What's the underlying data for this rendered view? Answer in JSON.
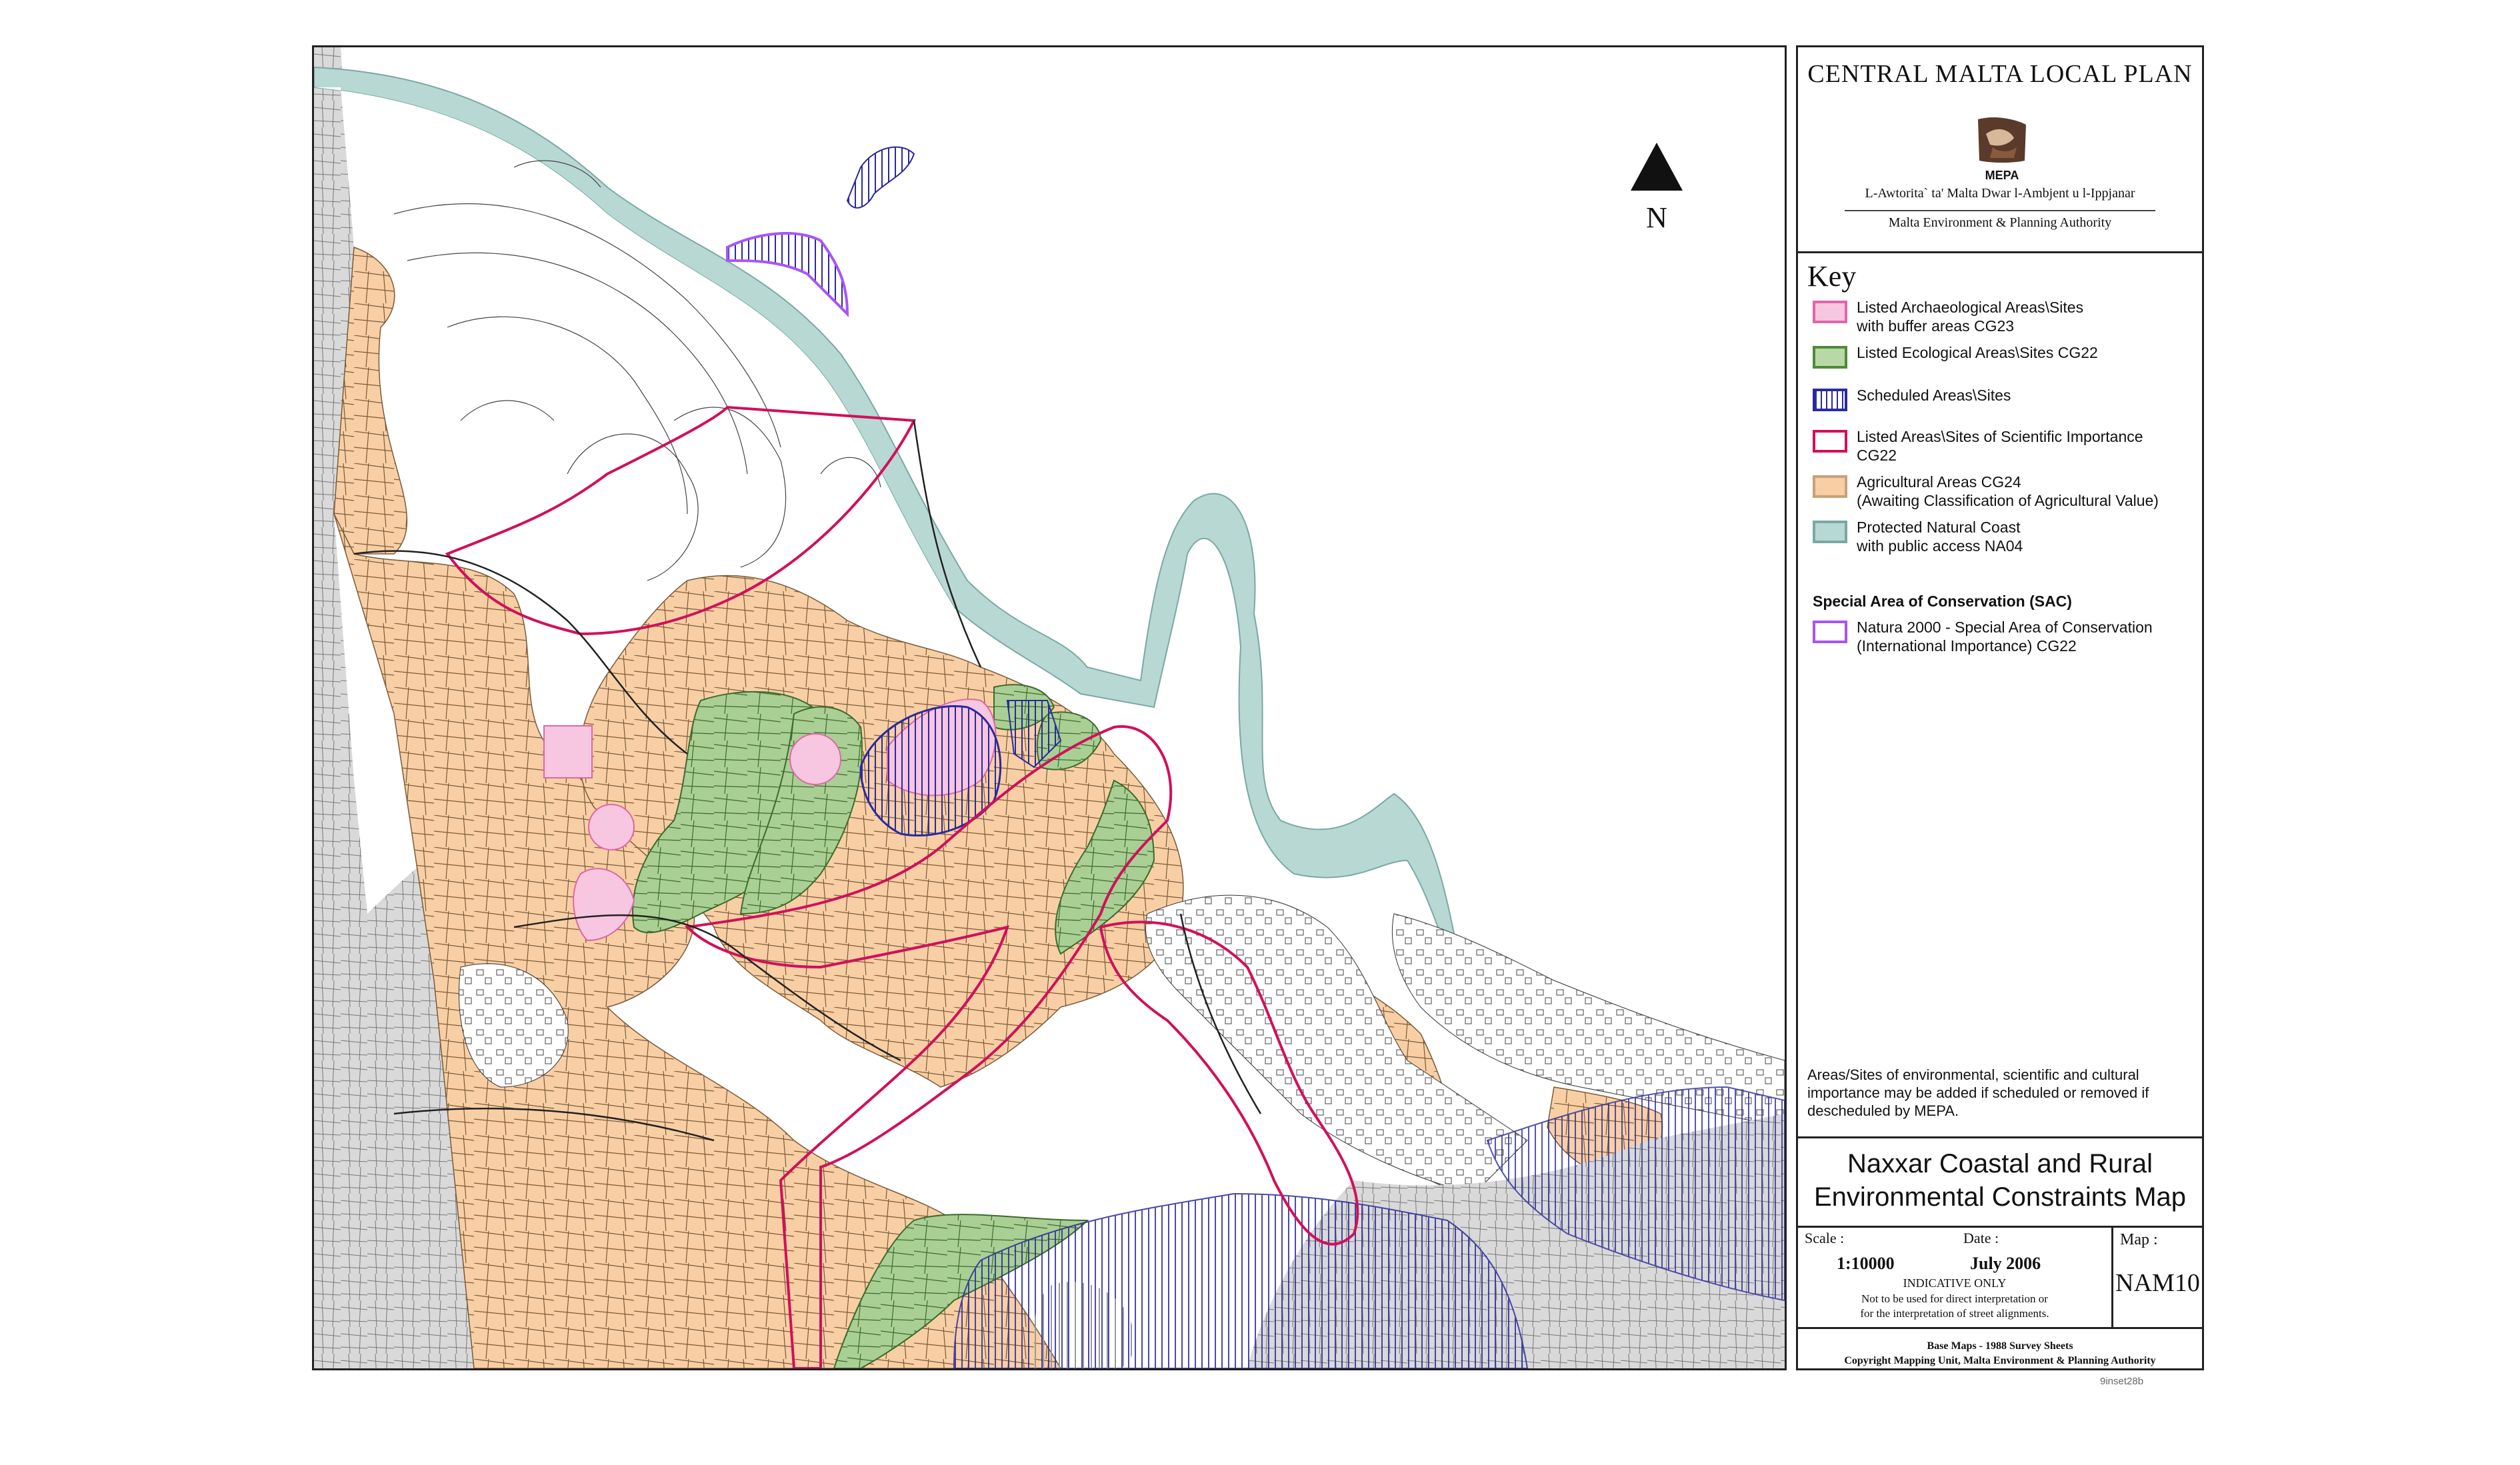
{
  "map": {
    "north_label": "N",
    "colors": {
      "archaeological_fill": "#f7c6e0",
      "archaeological_border": "#e066a8",
      "ecological_fill": "#b8d9a6",
      "ecological_border": "#4f8a3a",
      "scheduled_border": "#2a2aa0",
      "scientific_border": "#d1105a",
      "agricultural_fill": "#f8cfa4",
      "coast_fill": "#b8d8d4",
      "coast_border": "#7aa8a4",
      "sac_border": "#a855f7",
      "built_grey": "#d9d9d9"
    }
  },
  "panel": {
    "plan_title": "CENTRAL MALTA LOCAL PLAN",
    "logo_label": "MEPA",
    "authority_local": "L-Awtorita` ta' Malta Dwar l-Ambjent u l-Ippjanar",
    "authority_en": "Malta Environment & Planning Authority",
    "key_heading": "Key",
    "legend": [
      {
        "line1": "Listed Archaeological Areas\\Sites",
        "line2": "with buffer areas CG23"
      },
      {
        "line1": "Listed Ecological Areas\\Sites CG22",
        "line2": ""
      },
      {
        "line1": "Scheduled Areas\\Sites",
        "line2": ""
      },
      {
        "line1": "Listed Areas\\Sites of Scientific Importance",
        "line2": "CG22"
      },
      {
        "line1": "Agricultural Areas CG24",
        "line2": "(Awaiting Classification of Agricultural Value)"
      },
      {
        "line1": "Protected Natural Coast",
        "line2": "with public access NA04"
      }
    ],
    "sac_heading": "Special Area of Conservation (SAC)",
    "sac_item": {
      "line1": "Natura 2000 - Special Area of Conservation",
      "line2": "(International Importance) CG22"
    },
    "note": "Areas/Sites of environmental, scientific and cultural importance may be added if scheduled or removed if descheduled by MEPA.",
    "map_name_line1": "Naxxar Coastal and Rural",
    "map_name_line2": "Environmental Constraints Map",
    "scale_label": "Scale :",
    "scale_value": "1:10000",
    "date_label": "Date :",
    "date_value": "July 2006",
    "indicative": "INDICATIVE ONLY",
    "disclaimer1": "Not to be used for direct interpretation or",
    "disclaimer2": "for the interpretation of street alignments.",
    "map_label": "Map :",
    "map_code": "NAM10",
    "footer1": "Base Maps - 1988 Survey Sheets",
    "footer2": "Copyright Mapping Unit, Malta Environment & Planning Authority"
  },
  "ref_code": "9inset28b"
}
